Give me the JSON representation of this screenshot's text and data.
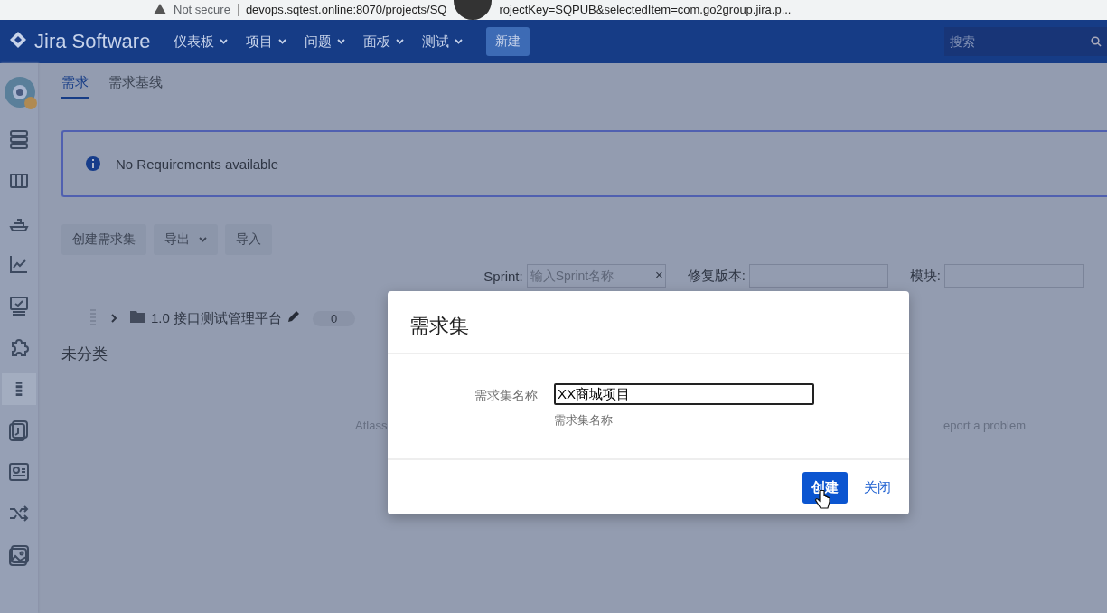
{
  "browser": {
    "not_secure": "Not secure",
    "url": "devops.sqtest.online:8070/projects/SQ",
    "url_tail": "rojectKey=SQPUB&selectedItem=com.go2group.jira.p..."
  },
  "nav": {
    "logo": "Jira Software",
    "menus": [
      {
        "label": "仪表板",
        "dropdown": true
      },
      {
        "label": "项目",
        "dropdown": true
      },
      {
        "label": "问题",
        "dropdown": true
      },
      {
        "label": "面板",
        "dropdown": true
      },
      {
        "label": "测试",
        "dropdown": true
      }
    ],
    "create": "新建",
    "search": {
      "placeholder": "搜索"
    }
  },
  "sidebar": {
    "items": [
      {
        "kind": "stack",
        "selected": false
      },
      {
        "kind": "board",
        "selected": false
      },
      {
        "kind": "ship",
        "selected": false
      },
      {
        "kind": "chart",
        "selected": false
      },
      {
        "kind": "monitor",
        "selected": false
      },
      {
        "kind": "puzzle",
        "selected": false
      },
      {
        "kind": "list",
        "selected": true
      },
      {
        "kind": "page",
        "selected": false
      },
      {
        "kind": "card",
        "selected": false
      },
      {
        "kind": "shuffle",
        "selected": false
      },
      {
        "kind": "image",
        "selected": false
      }
    ]
  },
  "tabs": [
    {
      "label": "需求",
      "selected": true
    },
    {
      "label": "需求基线",
      "selected": false
    }
  ],
  "info": {
    "message": "No Requirements available"
  },
  "toolbar": [
    {
      "label": "创建需求集",
      "dropdown": false
    },
    {
      "label": "导出",
      "dropdown": true
    },
    {
      "label": "导入",
      "dropdown": false
    }
  ],
  "filters": [
    {
      "label": "Sprint:",
      "placeholder": "输入Sprint名称",
      "clear": "×"
    },
    {
      "label": "修复版本:"
    },
    {
      "label": "模块:"
    }
  ],
  "tree": [
    {
      "label": "1.0 接口测试管理平台",
      "count": "0",
      "expanded": false
    }
  ],
  "uncategorized": "未分类",
  "footer": {
    "left": "Atlass",
    "right": "eport a problem"
  },
  "dialog": {
    "title": "需求集",
    "field": {
      "label": "需求集名称",
      "value": "XX商城项目",
      "hint": "需求集名称"
    },
    "buttons": [
      {
        "kind": "primary",
        "label": "创建"
      },
      {
        "kind": "link",
        "label": "关闭"
      }
    ]
  }
}
